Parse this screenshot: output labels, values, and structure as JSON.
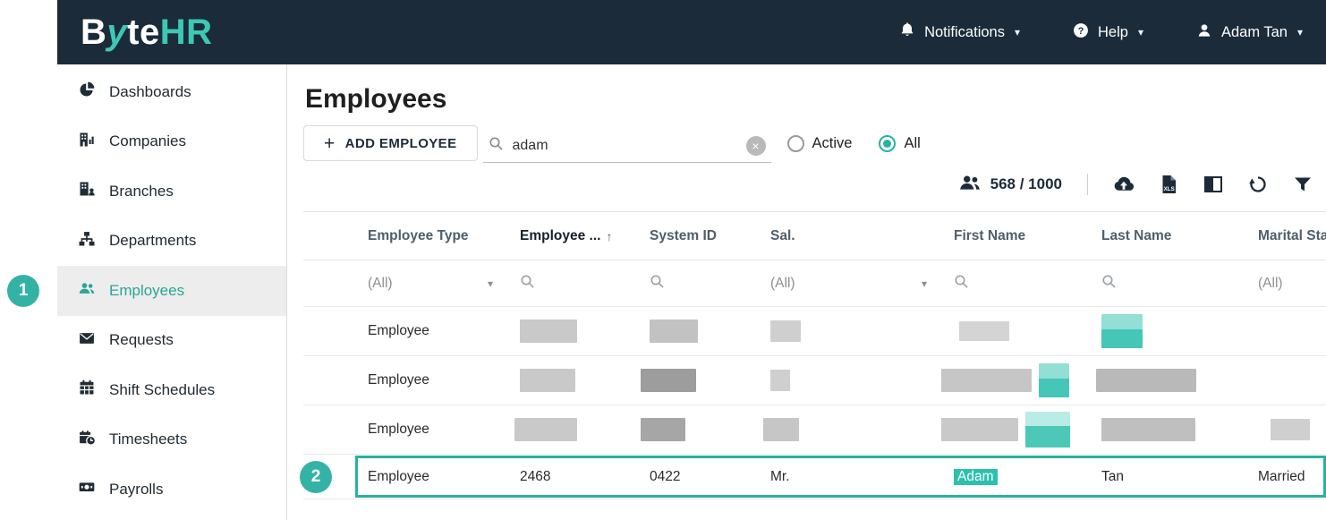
{
  "annotations": {
    "step_1": "1",
    "step_2": "2"
  },
  "colors": {
    "accent": "#2bb3a4",
    "topbar_bg": "#1c2b3a",
    "highlight_border": "#26b29f"
  },
  "topbar": {
    "logo": {
      "b": "B",
      "y": "y",
      "te": "te",
      "hr": "HR"
    },
    "notifications_label": "Notifications",
    "help_label": "Help",
    "user_name": "Adam Tan"
  },
  "sidebar": {
    "items": [
      {
        "label": "Dashboards"
      },
      {
        "label": "Companies"
      },
      {
        "label": "Branches"
      },
      {
        "label": "Departments"
      },
      {
        "label": "Employees"
      },
      {
        "label": "Requests"
      },
      {
        "label": "Shift Schedules"
      },
      {
        "label": "Timesheets"
      },
      {
        "label": "Payrolls"
      }
    ]
  },
  "main": {
    "title": "Employees",
    "add_button_label": "ADD EMPLOYEE",
    "search_value": "adam",
    "filter_active_label": "Active",
    "filter_all_label": "All",
    "record_count": "568 / 1000",
    "xls_badge": "XLS",
    "icons": {
      "caret_down": "▾",
      "sort_asc": "↑",
      "plus": "+",
      "clear": "×"
    },
    "table": {
      "headers": {
        "employee_type": "Employee Type",
        "employee_no": "Employee ...",
        "system_id": "System ID",
        "sal": "Sal.",
        "first_name": "First Name",
        "last_name": "Last Name",
        "marital_status": "Marital Sta"
      },
      "filter_all": "(All)",
      "rows": [
        {
          "employee_type": "Employee"
        },
        {
          "employee_type": "Employee"
        },
        {
          "employee_type": "Employee"
        },
        {
          "employee_type": "Employee",
          "employee_no": "2468",
          "system_id": "0422",
          "sal": "Mr.",
          "first_name": "Adam",
          "last_name": "Tan",
          "marital_status": "Married"
        }
      ]
    }
  }
}
